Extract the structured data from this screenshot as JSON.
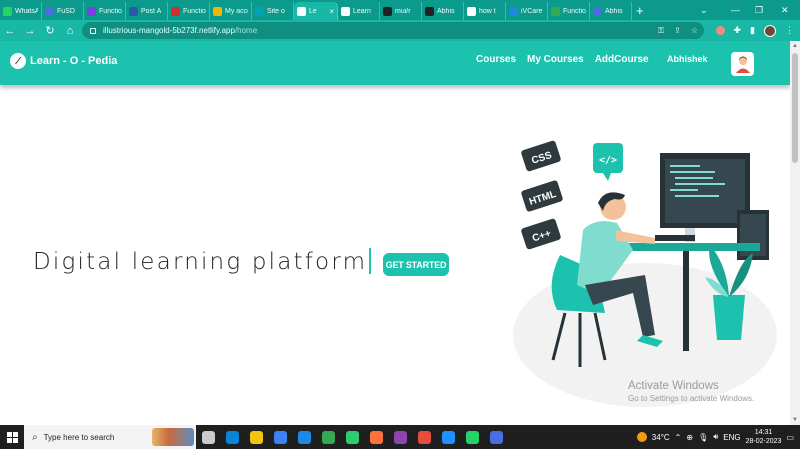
{
  "browser": {
    "tabs": [
      {
        "label": "WhatsApp",
        "color": "#25d366"
      },
      {
        "label": "FuSD",
        "color": "#4a6ee0"
      },
      {
        "label": "Functions",
        "color": "#7b3fe4"
      },
      {
        "label": "Post A",
        "color": "#2a5ba8"
      },
      {
        "label": "Functions",
        "color": "#d32f2f"
      },
      {
        "label": "My account",
        "color": "#f4b400"
      },
      {
        "label": "Site o",
        "color": "#00a2b8"
      },
      {
        "label": "Le",
        "color": "#ffffff",
        "active": true
      },
      {
        "label": "Learn",
        "color": "#ffffff"
      },
      {
        "label": "mui/r",
        "color": "#222222"
      },
      {
        "label": "Abhis",
        "color": "#222222"
      },
      {
        "label": "how t",
        "color": "#ffffff"
      },
      {
        "label": "iVCare",
        "color": "#1e88e5"
      },
      {
        "label": "Functio",
        "color": "#34a853"
      },
      {
        "label": "Abhis",
        "color": "#4a6ee0"
      }
    ],
    "active_tab_close": "×",
    "new_tab": "+",
    "url_host": "illustrious-mangold-5b273f.netlify.app",
    "url_path": "/home"
  },
  "navbar": {
    "brand": "Learn - O - Pedia",
    "links": [
      "Courses",
      "My Courses",
      "AddCourse"
    ],
    "username": "Abhishek"
  },
  "hero": {
    "headline": "Digital learning platform",
    "cta": "GET STARTED"
  },
  "illustration": {
    "labels": [
      "CSS",
      "HTML",
      "C++",
      "</>"
    ],
    "accent": "#1cc2ae"
  },
  "watermark": {
    "title": "Activate Windows",
    "subtitle": "Go to Settings to activate Windows."
  },
  "taskbar": {
    "search_placeholder": "Type here to search",
    "weather": "34°C",
    "language": "ENG",
    "time": "14:31",
    "date": "28-02-2023"
  },
  "colors": {
    "primary": "#1cc2ae",
    "chrome_frame": "#0c9a8c",
    "chrome_toolbar": "#19b8a6"
  }
}
